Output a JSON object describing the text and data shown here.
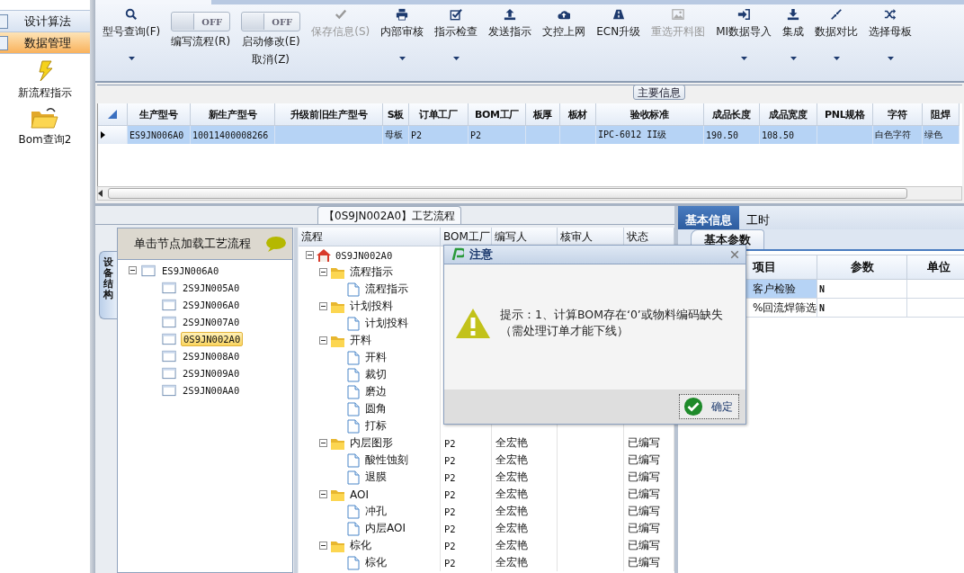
{
  "sidebar": {
    "nav": [
      {
        "label": "设计算法",
        "selected": false
      },
      {
        "label": "数据管理",
        "selected": true
      }
    ],
    "tiles": [
      {
        "label": "新流程指示"
      },
      {
        "label": "Bom查询2"
      }
    ]
  },
  "ribbon": {
    "items": [
      {
        "kind": "button",
        "label": "型号查询(F)",
        "dropdown": true,
        "disabled": false
      },
      {
        "kind": "toggle",
        "switch": "OFF",
        "on": false,
        "label": "编写流程(R)"
      },
      {
        "kind": "toggle",
        "switch": "OFF",
        "on": false,
        "label": "启动修改(E)",
        "sublabel": "取消(Z)"
      },
      {
        "kind": "button",
        "label": "保存信息(S)",
        "dropdown": false,
        "disabled": true
      },
      {
        "kind": "button",
        "label": "内部审核",
        "dropdown": true,
        "disabled": false
      },
      {
        "kind": "button",
        "label": "指示检查",
        "dropdown": true,
        "disabled": false
      },
      {
        "kind": "button",
        "label": "发送指示",
        "dropdown": false,
        "disabled": false
      },
      {
        "kind": "button",
        "label": "文控上网",
        "dropdown": false,
        "disabled": false
      },
      {
        "kind": "button",
        "label": "ECN升级",
        "dropdown": false,
        "disabled": false
      },
      {
        "kind": "button",
        "label": "重选开料图",
        "dropdown": false,
        "disabled": true
      },
      {
        "kind": "button",
        "label": "MI数据导入",
        "dropdown": true,
        "disabled": false
      },
      {
        "kind": "button",
        "label": "集成",
        "dropdown": true,
        "disabled": false
      },
      {
        "kind": "button",
        "label": "数据对比",
        "dropdown": true,
        "disabled": false
      },
      {
        "kind": "button",
        "label": "选择母板",
        "dropdown": true,
        "disabled": false
      }
    ]
  },
  "main_info": {
    "title": "主要信息",
    "columns": [
      "生产型号",
      "新生产型号",
      "升级前旧生产型号",
      "S板",
      "订单工厂",
      "BOM工厂",
      "板厚",
      "板材",
      "验收标准",
      "成品长度",
      "成品宽度",
      "PNL规格",
      "字符",
      "阻焊"
    ],
    "rows": [
      {
        "selected": true,
        "cells": [
          "ES9JN006A0",
          "10011400008266",
          null,
          "母板",
          "P2",
          "P2",
          null,
          null,
          "IPC-6012 II级",
          "190.50",
          "108.50",
          null,
          "白色字符",
          "绿色"
        ]
      }
    ]
  },
  "process": {
    "tab": "【0S9JN002A0】工艺流程",
    "side_tab": "设备结构",
    "tree_header": "单击节点加载工艺流程",
    "tree": [
      {
        "label": "ES9JN006A0",
        "expanded": true,
        "selected": false,
        "children": [
          {
            "label": "2S9JN005A0",
            "selected": false
          },
          {
            "label": "2S9JN006A0",
            "selected": false
          },
          {
            "label": "2S9JN007A0",
            "selected": false
          },
          {
            "label": "0S9JN002A0",
            "selected": true
          },
          {
            "label": "2S9JN008A0",
            "selected": false
          },
          {
            "label": "2S9JN009A0",
            "selected": false
          },
          {
            "label": "2S9JN00AA0",
            "selected": false
          }
        ]
      }
    ],
    "flow_columns": [
      "流程",
      "BOM工厂",
      "编写人",
      "核审人",
      "状态"
    ],
    "flow": [
      {
        "label": "0S9JN002A0",
        "kind": "root",
        "expanded": true,
        "children": [
          {
            "label": "流程指示",
            "kind": "folder",
            "expanded": true,
            "children": [
              {
                "label": "流程指示",
                "kind": "leaf"
              }
            ]
          },
          {
            "label": "计划投料",
            "kind": "folder",
            "expanded": true,
            "children": [
              {
                "label": "计划投料",
                "kind": "leaf"
              }
            ]
          },
          {
            "label": "开料",
            "kind": "folder",
            "expanded": true,
            "children": [
              {
                "label": "开料",
                "kind": "leaf"
              },
              {
                "label": "裁切",
                "kind": "leaf"
              },
              {
                "label": "磨边",
                "kind": "leaf"
              },
              {
                "label": "圆角",
                "kind": "leaf"
              },
              {
                "label": "打标",
                "kind": "leaf"
              }
            ]
          },
          {
            "label": "内层图形",
            "kind": "folder",
            "expanded": true,
            "bom": "P2",
            "writer": "全宏艳",
            "status": "已编写",
            "children": [
              {
                "label": "酸性蚀刻",
                "kind": "leaf",
                "bom": "P2",
                "writer": "全宏艳",
                "status": "已编写"
              },
              {
                "label": "退膜",
                "kind": "leaf",
                "bom": "P2",
                "writer": "全宏艳",
                "status": "已编写"
              }
            ]
          },
          {
            "label": "AOI",
            "kind": "folder",
            "expanded": true,
            "bom": "P2",
            "writer": "全宏艳",
            "status": "已编写",
            "children": [
              {
                "label": "冲孔",
                "kind": "leaf",
                "bom": "P2",
                "writer": "全宏艳",
                "status": "已编写"
              },
              {
                "label": "内层AOI",
                "kind": "leaf",
                "bom": "P2",
                "writer": "全宏艳",
                "status": "已编写"
              }
            ]
          },
          {
            "label": "棕化",
            "kind": "folder",
            "expanded": true,
            "bom": "P2",
            "writer": "全宏艳",
            "status": "已编写",
            "children": [
              {
                "label": "棕化",
                "kind": "leaf",
                "bom": "P2",
                "writer": "全宏艳",
                "status": "已编写"
              }
            ]
          }
        ]
      }
    ]
  },
  "details": {
    "tabs": [
      {
        "label": "基本信息",
        "selected": true
      },
      {
        "label": "工时",
        "selected": false
      }
    ],
    "subtab": "基本参数",
    "columns": [
      "项目",
      "参数",
      "单位"
    ],
    "rows": [
      {
        "item": "客户检验",
        "value": "N",
        "selected": true
      },
      {
        "item": "%回流焊筛选",
        "value": "N",
        "selected": false
      }
    ]
  },
  "dialog": {
    "title": "注意",
    "message": "提示：1、计算BOM存在‘0’或物料编码缺失（需处理订单才能下线）",
    "ok": "确定"
  }
}
